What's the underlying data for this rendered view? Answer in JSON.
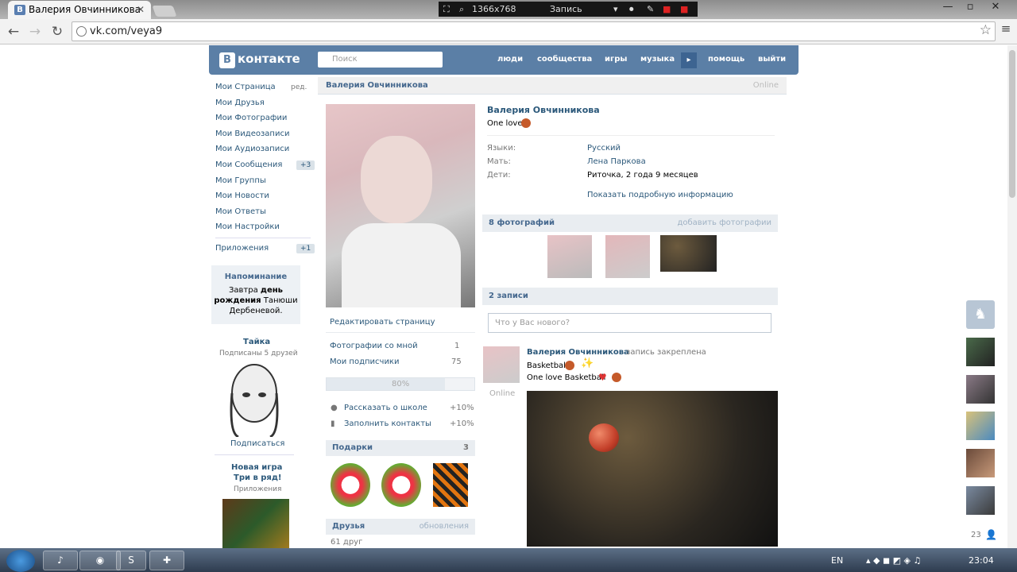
{
  "browser": {
    "tab_title": "Валерия Овчинникова",
    "tab_favicon": "В",
    "tab_close": "✕",
    "url": "vk.com/veya9",
    "nav_back": "←",
    "nav_forward": "→",
    "nav_reload": "↻",
    "star_icon": "☆",
    "menu_icon": "≡"
  },
  "recorder": {
    "resolution": "1366x768",
    "label": "Запись",
    "icons": [
      "⛶",
      "⌕",
      "▾",
      "⏺",
      "✎",
      "■",
      "■"
    ]
  },
  "window_controls": {
    "minimize": "—",
    "maximize": "▫",
    "close": "✕"
  },
  "vk_header": {
    "logo_b": "В",
    "logo_text": "контакте",
    "search_placeholder": "Поиск",
    "nav": [
      "люди",
      "сообщества",
      "игры",
      "музыка",
      "помощь",
      "выйти"
    ],
    "more": "▸"
  },
  "left_menu": {
    "items": [
      "Мои Страница",
      "Мои Друзья",
      "Мои Фотографии",
      "Мои Видеозаписи",
      "Мои Аудиозаписи",
      "Мои Сообщения",
      "Мои Группы",
      "Мои Новости",
      "Мои Ответы",
      "Мои Настройки",
      "Приложения"
    ],
    "edit": "ред.",
    "messages_badge": "+3",
    "apps_badge": "+1"
  },
  "reminder": {
    "title": "Напоминание",
    "line1": "Завтра",
    "bold1": "день",
    "bold2": "рождения",
    "line2": "Танюши",
    "line3": "Дербеневой."
  },
  "promo": {
    "name": "Тайка",
    "subs": "Подписаны 5 друзей",
    "subscribe": "Подписаться",
    "game_title1": "Новая игра",
    "game_title2": "Три в ряд!",
    "game_cat": "Приложения"
  },
  "profile_bar": {
    "name": "Валерия Овчинникова",
    "status": "Online"
  },
  "profile_left": {
    "edit_page": "Редактировать страницу",
    "photos_with_me": "Фотографии со мной",
    "photos_with_me_count": "1",
    "subscribers": "Мои подписчики",
    "subscribers_count": "75",
    "progress_label": "80%",
    "progress": 0.8,
    "tell_school": "Рассказать о школе",
    "tell_school_pct": "+10%",
    "fill_contacts": "Заполнить контакты",
    "fill_contacts_pct": "+10%",
    "gifts_title": "Подарки",
    "gifts_count": "3",
    "friends_title": "Друзья",
    "friends_updates": "обновления",
    "friends_count": "61 друг"
  },
  "info": {
    "name": "Валерия Овчинникова",
    "status": "One love",
    "rows": [
      {
        "k": "Языки:",
        "v": "Русский"
      },
      {
        "k": "Мать:",
        "v": "Лена Паркова"
      },
      {
        "k": "Дети:",
        "v": "Риточка, 2 года 9 месяцев"
      }
    ],
    "show_more": "Показать подробную информацию"
  },
  "photos": {
    "title": "8 фотографий",
    "add": "добавить фотографии"
  },
  "wall": {
    "title": "2 записи",
    "placeholder": "Что у Вас нового?",
    "post_author": "Валерия Овчинникова",
    "post_pinned": "запись закреплена",
    "post_line1": "Basketball",
    "post_line2": "One love Basketball",
    "post_online": "Online"
  },
  "right_sidebar": {
    "count": "23"
  },
  "taskbar": {
    "lang": "EN",
    "clock": "23:04"
  },
  "colors": {
    "vk_blue": "#5b7fa6",
    "link": "#2b587a"
  }
}
